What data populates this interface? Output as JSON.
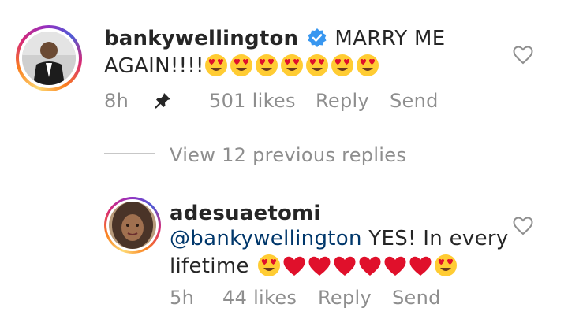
{
  "comment": {
    "username": "bankywellington",
    "verified": true,
    "text_line1": "MARRY ME",
    "text_line2": "AGAIN!!!!",
    "emojis": [
      "heart-eyes",
      "heart-eyes",
      "heart-eyes",
      "heart-eyes",
      "heart-eyes",
      "heart-eyes",
      "heart-eyes"
    ],
    "time": "8h",
    "pinned": true,
    "likes": "501 likes",
    "reply_label": "Reply",
    "send_label": "Send"
  },
  "view_replies": {
    "label": "View 12 previous replies"
  },
  "reply": {
    "username": "adesuaetomi",
    "mention": "@bankywellington",
    "text_after_mention": " YES! In every",
    "text_line2": "lifetime",
    "emojis": [
      "heart-eyes",
      "red-heart",
      "red-heart",
      "red-heart",
      "red-heart",
      "red-heart",
      "red-heart",
      "heart-eyes"
    ],
    "time": "5h",
    "likes": "44 likes",
    "reply_label": "Reply",
    "send_label": "Send"
  },
  "colors": {
    "verified_blue": "#3897f0",
    "meta_gray": "#8e8e8e",
    "mention_blue": "#00376b",
    "emoji_yellow": "#ffcc33",
    "heart_red": "#e0102b"
  }
}
